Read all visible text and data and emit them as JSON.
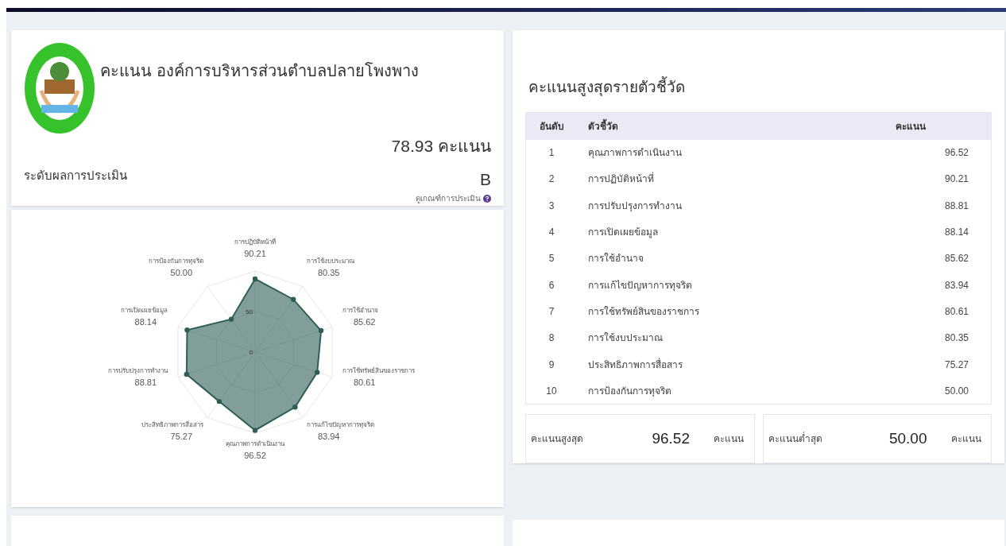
{
  "summary": {
    "title": "คะแนน องค์การบริหารส่วนตำบลปลายโพงพาง",
    "score": "78.93 คะแนน",
    "level_label": "ระดับผลการประเมิน",
    "grade": "B",
    "criteria_link": "ดูเกณฑ์การประเมิน"
  },
  "radar": {
    "ring_labels": [
      "50",
      "0"
    ],
    "top_axis": {
      "label": "การปฏิบัติหน้าที่",
      "value": "90.21"
    },
    "left_axes": [
      {
        "label": "การป้องกันการทุจริต",
        "value": "50.00"
      },
      {
        "label": "การเปิดเผยข้อมูล",
        "value": "88.14"
      },
      {
        "label": "การปรับปรุงการทำงาน",
        "value": "88.81"
      },
      {
        "label": "ประสิทธิภาพการสื่อสาร",
        "value": "75.27"
      }
    ],
    "right_axes": [
      {
        "label": "การใช้งบประมาณ",
        "value": "80.35"
      },
      {
        "label": "การใช้อำนาจ",
        "value": "85.62"
      },
      {
        "label": "การใช้ทรัพย์สินของราชการ",
        "value": "80.61"
      },
      {
        "label": "การแก้ไขปัญหาการทุจริต",
        "value": "83.94"
      }
    ],
    "bottom_axis": {
      "label": "คุณภาพการดำเนินงาน",
      "value": "96.52"
    }
  },
  "ranking": {
    "title": "คะแนนสูงสุดรายตัวชี้วัด",
    "columns": [
      "อันดับ",
      "ตัวชี้วัด",
      "คะแนน"
    ],
    "rows": [
      {
        "rank": "1",
        "indicator": "คุณภาพการดำเนินงาน",
        "score": "96.52"
      },
      {
        "rank": "2",
        "indicator": "การปฏิบัติหน้าที่",
        "score": "90.21"
      },
      {
        "rank": "3",
        "indicator": "การปรับปรุงการทำงาน",
        "score": "88.81"
      },
      {
        "rank": "4",
        "indicator": "การเปิดเผยข้อมูล",
        "score": "88.14"
      },
      {
        "rank": "5",
        "indicator": "การใช้อำนาจ",
        "score": "85.62"
      },
      {
        "rank": "6",
        "indicator": "การแก้ไขปัญหาการทุจริต",
        "score": "83.94"
      },
      {
        "rank": "7",
        "indicator": "การใช้ทรัพย์สินของราชการ",
        "score": "80.61"
      },
      {
        "rank": "8",
        "indicator": "การใช้งบประมาณ",
        "score": "80.35"
      },
      {
        "rank": "9",
        "indicator": "ประสิทธิภาพการสื่อสาร",
        "score": "75.27"
      },
      {
        "rank": "10",
        "indicator": "การป้องกันการทุจริต",
        "score": "50.00"
      }
    ],
    "stats": [
      {
        "label": "คะแนนสูงสุด",
        "value": "96.52",
        "unit": "คะแนน"
      },
      {
        "label": "คะแนนต่ำสุด",
        "value": "50.00",
        "unit": "คะแนน"
      }
    ]
  }
}
